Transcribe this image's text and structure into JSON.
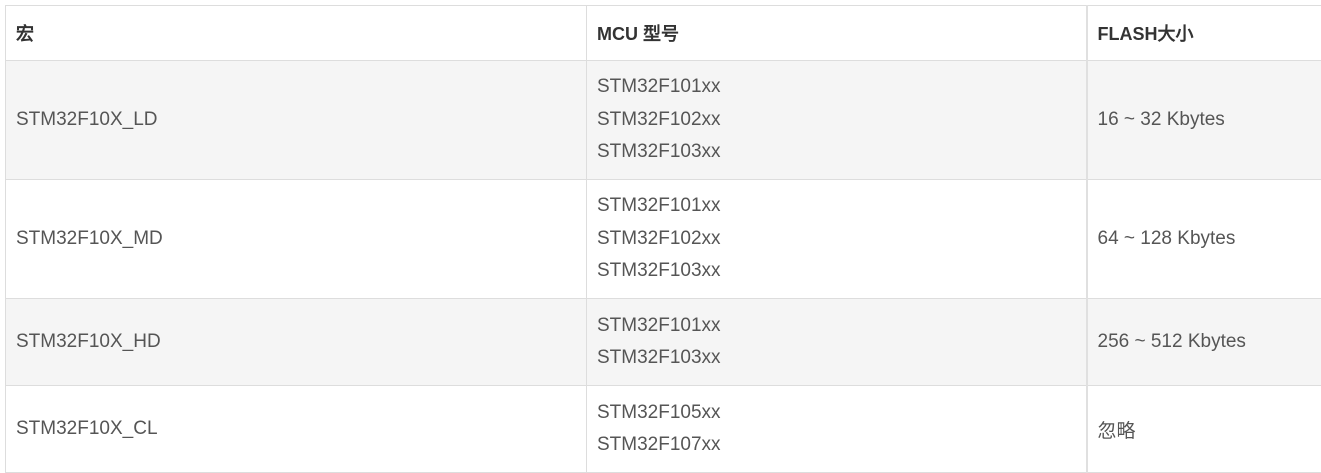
{
  "table": {
    "headers": [
      "宏",
      "MCU 型号",
      "FLASH大小"
    ],
    "rows": [
      {
        "macro": "STM32F10X_LD",
        "mcus": [
          "STM32F101xx",
          "STM32F102xx",
          "STM32F103xx"
        ],
        "flash": "16 ~ 32 Kbytes"
      },
      {
        "macro": "STM32F10X_MD",
        "mcus": [
          "STM32F101xx",
          "STM32F102xx",
          "STM32F103xx"
        ],
        "flash": "64 ~ 128 Kbytes"
      },
      {
        "macro": "STM32F10X_HD",
        "mcus": [
          "STM32F101xx",
          "STM32F103xx"
        ],
        "flash": "256 ~ 512 Kbytes"
      },
      {
        "macro": "STM32F10X_CL",
        "mcus": [
          "STM32F105xx",
          "STM32F107xx"
        ],
        "flash": "忽略"
      }
    ]
  }
}
